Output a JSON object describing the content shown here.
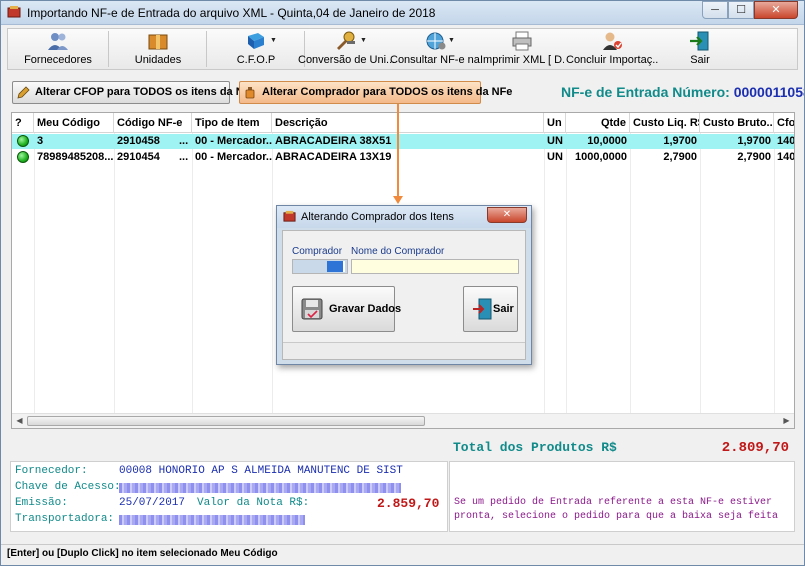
{
  "window": {
    "title": "Importando NF-e de Entrada do arquivo XML - Quinta,04 de Janeiro de 2018",
    "minimize": "─",
    "maximize": "☐",
    "close": "✕"
  },
  "toolbar": {
    "items": [
      {
        "label": "Fornecedores",
        "icon": "users-icon"
      },
      {
        "label": "Unidades",
        "icon": "box-icon"
      },
      {
        "label": "C.F.O.P",
        "icon": "book-icon"
      },
      {
        "label": "Conversão de Uni...",
        "icon": "tools-icon"
      },
      {
        "label": "Consultar NF-e na...",
        "icon": "globe-settings-icon"
      },
      {
        "label": "Imprimir XML [ D...",
        "icon": "printer-icon"
      },
      {
        "label": "Concluir Importaç...",
        "icon": "user-check-icon"
      },
      {
        "label": "Sair",
        "icon": "exit-door-icon"
      }
    ]
  },
  "actions": {
    "alterar_cfop": "Alterar CFOP para TODOS os itens da NFe",
    "alterar_comprador": "Alterar Comprador para TODOS os itens da NFe"
  },
  "nfe": {
    "label": "NF-e de Entrada Número:",
    "number": "0000011058"
  },
  "grid": {
    "columns": [
      "?",
      "Meu Código",
      "Código NF-e",
      "Tipo de Item",
      "Descrição",
      "Un",
      "Qtde",
      "Custo Liq. R$",
      "Custo Bruto...",
      "Cfo"
    ],
    "rows": [
      {
        "meu_codigo": "3",
        "codigo_nfe": "2910458",
        "ellipsis": "...",
        "tipo": "00 - Mercador...",
        "descricao": "ABRACADEIRA 38X51",
        "un": "UN",
        "qtde": "10,0000",
        "custo_liq": "1,9700",
        "custo_bruto": "1,9700",
        "cfo": "140"
      },
      {
        "meu_codigo": "78989485208...",
        "codigo_nfe": "2910454",
        "ellipsis": "...",
        "tipo": "00 - Mercador...",
        "descricao": "ABRACADEIRA 13X19",
        "un": "UN",
        "qtde": "1000,0000",
        "custo_liq": "2,7900",
        "custo_bruto": "2,7900",
        "cfo": "140"
      }
    ]
  },
  "dialog": {
    "title": "Alterando Comprador dos Itens",
    "comprador_label": "Comprador",
    "nome_label": "Nome do Comprador",
    "gravar": "Gravar Dados",
    "sair": "Sair"
  },
  "totals": {
    "label": "Total dos Produtos R$",
    "value": "2.809,70"
  },
  "info": {
    "fornecedor_label": "Fornecedor:",
    "fornecedor_value": "00008 HONORIO AP S ALMEIDA MANUTENC DE SIST",
    "chave_label": "Chave de Acesso:",
    "emissao_label": "Emissão:",
    "emissao_value": "25/07/2017",
    "valor_label": "Valor da Nota R$:",
    "valor_value": "2.859,70",
    "transportadora_label": "Transportadora:",
    "note": "Se um pedido de Entrada referente a esta NF-e estiver pronta, selecione o pedido para que a baixa seja feita"
  },
  "status": {
    "text": "[Enter] ou [Duplo Click] no item selecionado Meu Código"
  },
  "colors": {
    "teal": "#118a8a",
    "blue": "#1b2fb0",
    "red": "#c01818",
    "selected_row": "#9ff3f3",
    "orange_accent": "#f08a3c"
  }
}
